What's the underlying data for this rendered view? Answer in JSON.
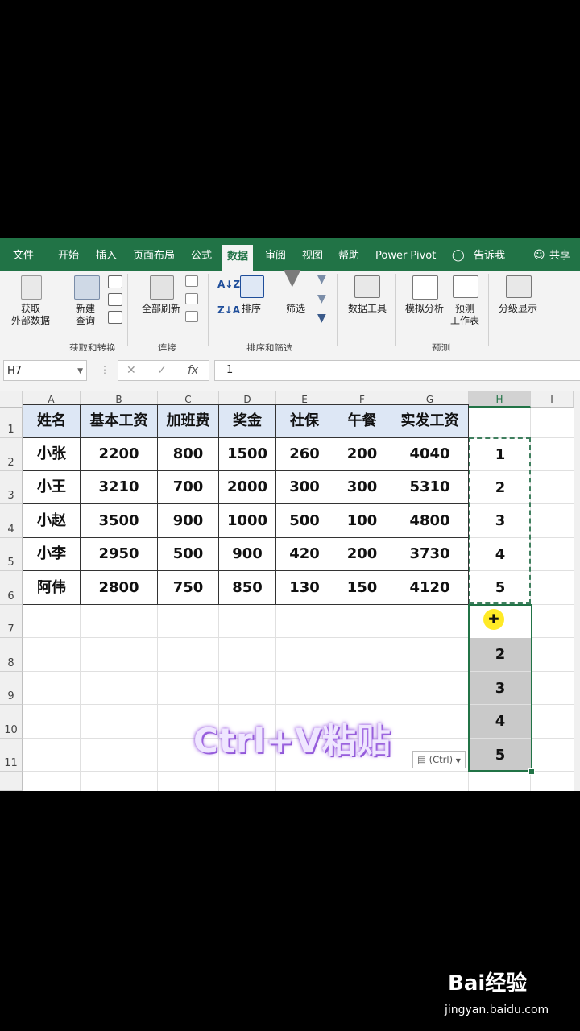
{
  "tabs": [
    "文件",
    "开始",
    "插入",
    "页面布局",
    "公式",
    "数据",
    "审阅",
    "视图",
    "帮助",
    "Power Pivot",
    "告诉我",
    "共享"
  ],
  "active_tab": "数据",
  "ribbon": {
    "get_external_line1": "获取",
    "get_external_line2": "外部数据",
    "new_query_line1": "新建",
    "new_query_line2": "查询",
    "refresh_all": "全部刷新",
    "sort": "排序",
    "filter": "筛选",
    "data_tools": "数据工具",
    "what_if": "模拟分析",
    "forecast_line1": "预测",
    "forecast_line2": "工作表",
    "outline": "分级显示",
    "groups": [
      "获取和转换",
      "连接",
      "排序和筛选",
      "预测"
    ]
  },
  "formula_bar": {
    "name_box": "H7",
    "cancel": "✕",
    "enter": "✓",
    "fx": "fx",
    "value": "1"
  },
  "columns": [
    "A",
    "B",
    "C",
    "D",
    "E",
    "F",
    "G",
    "H",
    "I"
  ],
  "rows": [
    "1",
    "2",
    "3",
    "4",
    "5",
    "6",
    "7",
    "8",
    "9",
    "10",
    "11"
  ],
  "table": {
    "headers": [
      "姓名",
      "基本工资",
      "加班费",
      "奖金",
      "社保",
      "午餐",
      "实发工资"
    ],
    "rows": [
      [
        "小张",
        "2200",
        "800",
        "1500",
        "260",
        "200",
        "4040"
      ],
      [
        "小王",
        "3210",
        "700",
        "2000",
        "300",
        "300",
        "5310"
      ],
      [
        "小赵",
        "3500",
        "900",
        "1000",
        "500",
        "100",
        "4800"
      ],
      [
        "小李",
        "2950",
        "500",
        "900",
        "420",
        "200",
        "3730"
      ],
      [
        "阿伟",
        "2800",
        "750",
        "850",
        "130",
        "150",
        "4120"
      ]
    ]
  },
  "h_values": [
    "1",
    "2",
    "3",
    "4",
    "5"
  ],
  "pasted_values": [
    "2",
    "3",
    "4",
    "5"
  ],
  "paste_options": "(Ctrl)",
  "caption": "Ctrl+V粘贴",
  "watermark": {
    "brand": "Bai经验",
    "url": "jingyan.baidu.com"
  },
  "colors": {
    "excel_green": "#217346",
    "header_fill": "#dde7f5",
    "pasted_fill": "#c9c9c9",
    "caption_glow": "#9b5fe0"
  }
}
